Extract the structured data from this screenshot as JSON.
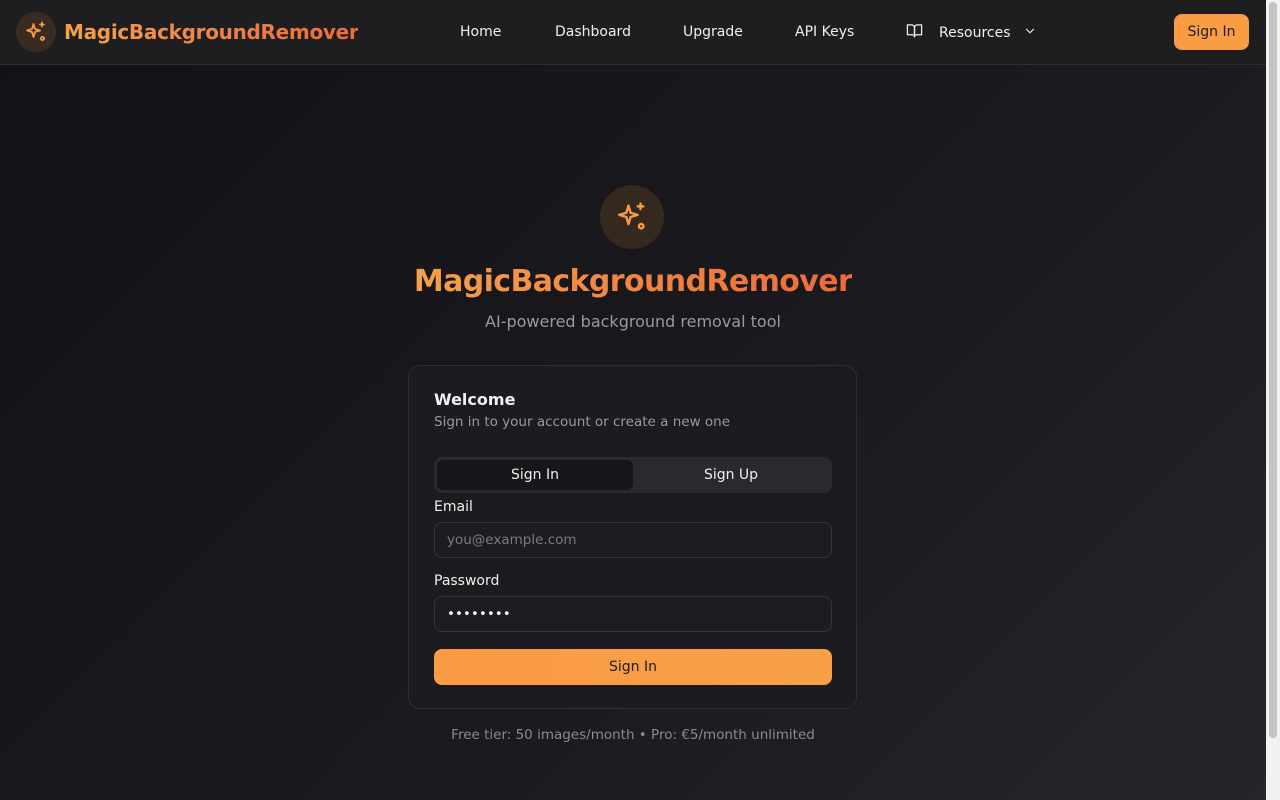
{
  "header": {
    "brand": "MagicBackgroundRemover",
    "nav": {
      "home": "Home",
      "dashboard": "Dashboard",
      "upgrade": "Upgrade",
      "api_keys": "API Keys",
      "resources": "Resources"
    },
    "sign_in": "Sign In"
  },
  "hero": {
    "title": "MagicBackgroundRemover",
    "subtitle": "AI-powered background removal tool"
  },
  "card": {
    "title": "Welcome",
    "description": "Sign in to your account or create a new one",
    "tabs": {
      "sign_in": "Sign In",
      "sign_up": "Sign Up"
    },
    "email_label": "Email",
    "email_placeholder": "you@example.com",
    "password_label": "Password",
    "password_value": "••••••••",
    "submit_label": "Sign In"
  },
  "footer": {
    "note": "Free tier: 50 images/month • Pro: €5/month unlimited"
  },
  "colors": {
    "accent": "#f99d45",
    "accent_gradient_end": "#ee6a3a",
    "background": "#141318"
  },
  "icons": {
    "brand": "sparkles-icon",
    "resources": "book-open-icon",
    "resources_toggle": "chevron-down-icon"
  }
}
